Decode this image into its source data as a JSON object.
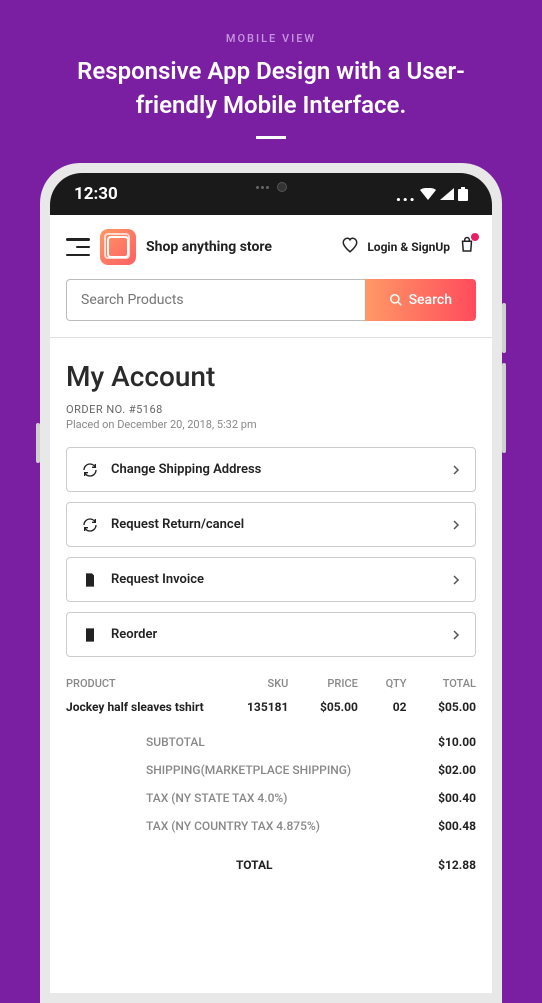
{
  "promo": {
    "label": "MOBILE VIEW",
    "title": "Responsive App Design with a User-friendly Mobile Interface."
  },
  "status": {
    "time": "12:30"
  },
  "header": {
    "brand": "Shop anything store",
    "login": "Login & SignUp"
  },
  "search": {
    "placeholder": "Search Products",
    "button": "Search"
  },
  "page": {
    "title": "My Account",
    "order_no": "ORDER NO. #5168",
    "order_date": "Placed on December 20, 2018, 5:32 pm"
  },
  "actions": {
    "shipping": "Change Shipping Address",
    "return": "Request Return/cancel",
    "invoice": "Request Invoice",
    "reorder": "Reorder"
  },
  "table": {
    "headers": {
      "product": "PRODUCT",
      "sku": "SKU",
      "price": "PRICE",
      "qty": "QTY",
      "total": "TOTAL"
    },
    "row": {
      "product": "Jockey half sleaves tshirt",
      "sku": "135181",
      "price": "$05.00",
      "qty": "02",
      "total": "$05.00"
    }
  },
  "summary": {
    "subtotal": {
      "label": "SUBTOTAL",
      "value": "$10.00"
    },
    "shipping": {
      "label": "SHIPPING(MARKETPLACE SHIPPING)",
      "value": "$02.00"
    },
    "tax1": {
      "label": "TAX (NY STATE TAX 4.0%)",
      "value": "$00.40"
    },
    "tax2": {
      "label": "TAX (NY COUNTRY TAX 4.875%)",
      "value": "$00.48"
    },
    "total": {
      "label": "TOTAL",
      "value": "$12.88"
    }
  }
}
